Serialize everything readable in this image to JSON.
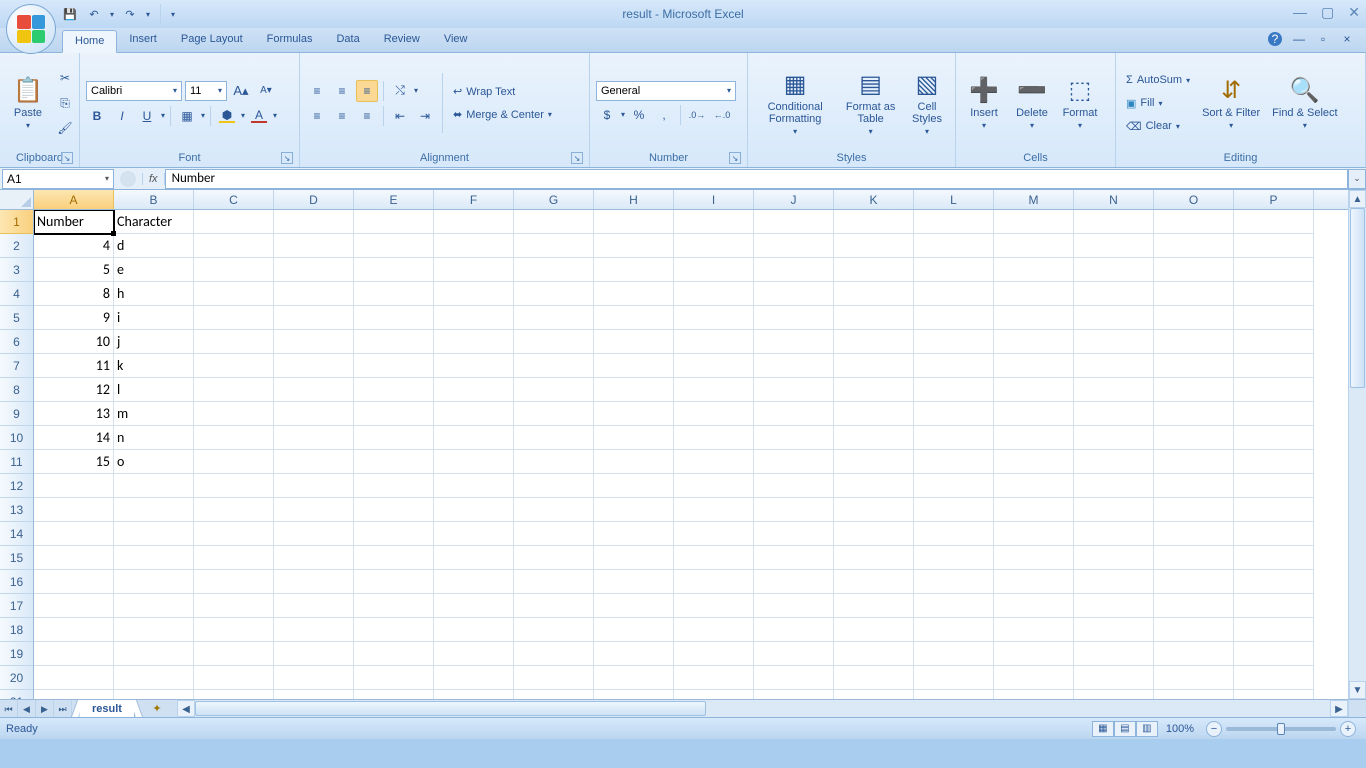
{
  "title": "result - Microsoft Excel",
  "qat": {
    "save": "💾",
    "undo": "↶",
    "redo": "↷"
  },
  "tabs": [
    "Home",
    "Insert",
    "Page Layout",
    "Formulas",
    "Data",
    "Review",
    "View"
  ],
  "active_tab": 0,
  "ribbon": {
    "clipboard": {
      "title": "Clipboard",
      "paste": "Paste"
    },
    "font": {
      "title": "Font",
      "name": "Calibri",
      "size": "11",
      "bold": "B",
      "italic": "I",
      "underline": "U"
    },
    "alignment": {
      "title": "Alignment",
      "wrap": "Wrap Text",
      "merge": "Merge & Center"
    },
    "number": {
      "title": "Number",
      "format": "General"
    },
    "styles": {
      "title": "Styles",
      "cond": "Conditional Formatting",
      "table": "Format as Table",
      "cell": "Cell Styles"
    },
    "cells": {
      "title": "Cells",
      "insert": "Insert",
      "delete": "Delete",
      "format": "Format"
    },
    "editing": {
      "title": "Editing",
      "autosum": "AutoSum",
      "fill": "Fill",
      "clear": "Clear",
      "sort": "Sort & Filter",
      "find": "Find & Select"
    }
  },
  "namebox": "A1",
  "formula": "Number",
  "columns": [
    "A",
    "B",
    "C",
    "D",
    "E",
    "F",
    "G",
    "H",
    "I",
    "J",
    "K",
    "L",
    "M",
    "N",
    "O",
    "P"
  ],
  "row_count": 21,
  "active_cell": {
    "row": 1,
    "col": 1
  },
  "data": {
    "1": {
      "1": "Number",
      "2": "Character"
    },
    "2": {
      "1": "4",
      "2": "d"
    },
    "3": {
      "1": "5",
      "2": "e"
    },
    "4": {
      "1": "8",
      "2": "h"
    },
    "5": {
      "1": "9",
      "2": "i"
    },
    "6": {
      "1": "10",
      "2": "j"
    },
    "7": {
      "1": "11",
      "2": "k"
    },
    "8": {
      "1": "12",
      "2": "l"
    },
    "9": {
      "1": "13",
      "2": "m"
    },
    "10": {
      "1": "14",
      "2": "n"
    },
    "11": {
      "1": "15",
      "2": "o"
    }
  },
  "numeric_cols": {
    "1": true
  },
  "header_rows": {
    "1": true
  },
  "sheet_tab": "result",
  "status": "Ready",
  "zoom": "100%"
}
